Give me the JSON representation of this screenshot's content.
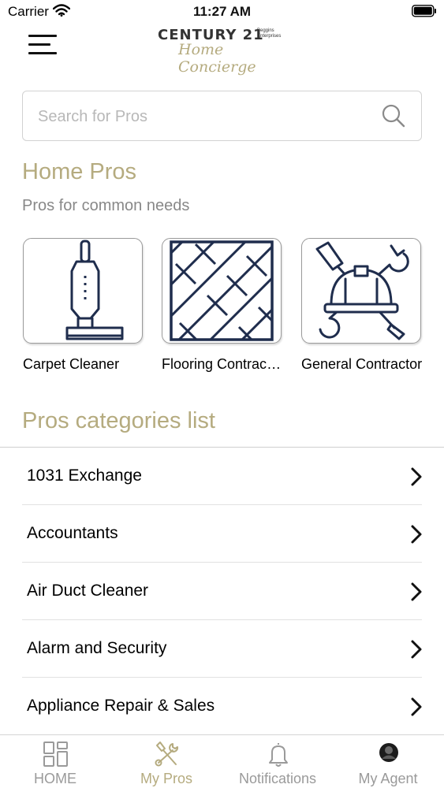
{
  "status_bar": {
    "carrier": "Carrier",
    "time": "11:27 AM"
  },
  "header": {
    "logo_main": "CENTURY 21",
    "logo_sub": "Beggins Enterprises",
    "logo_script": "Home Concierge"
  },
  "search": {
    "placeholder": "Search for Pros"
  },
  "home_pros": {
    "title": "Home Pros",
    "subtitle": "Pros for common needs",
    "cards": [
      {
        "label": "Carpet Cleaner",
        "icon": "vacuum-icon"
      },
      {
        "label": "Flooring Contractor",
        "icon": "floor-tiles-icon"
      },
      {
        "label": "General Contractor",
        "icon": "hardhat-tools-icon"
      }
    ]
  },
  "categories": {
    "title": "Pros categories list",
    "items": [
      {
        "label": "1031 Exchange"
      },
      {
        "label": "Accountants"
      },
      {
        "label": "Air Duct Cleaner"
      },
      {
        "label": "Alarm and Security"
      },
      {
        "label": "Appliance Repair & Sales"
      }
    ]
  },
  "tab_bar": {
    "tabs": [
      {
        "label": "HOME",
        "icon": "grid-icon",
        "active": false
      },
      {
        "label": "My Pros",
        "icon": "tools-icon",
        "active": true
      },
      {
        "label": "Notifications",
        "icon": "bell-icon",
        "active": false
      },
      {
        "label": "My Agent",
        "icon": "avatar-icon",
        "active": false
      }
    ]
  },
  "colors": {
    "accent": "#b5ab7f",
    "icon_navy": "#1f2d4d",
    "inactive": "#9a9a9a"
  }
}
